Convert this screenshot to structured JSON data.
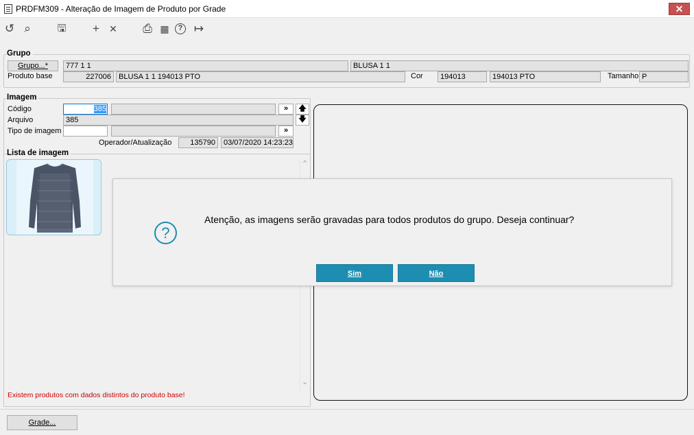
{
  "window": {
    "title": "PRDFM309 - Alteração de Imagem de Produto por Grade",
    "close": "✕"
  },
  "toolbar": {
    "icons": [
      "undo-icon",
      "search-icon",
      "save-icon",
      "add-icon",
      "delete-icon",
      "print-icon",
      "calendar-icon",
      "help-icon",
      "exit-icon"
    ],
    "glyphs": {
      "undo": "↺",
      "search": "⌕",
      "save": "🖫",
      "add": "+",
      "delete": "✕",
      "print": "⎙",
      "calendar": "▦",
      "help": "?",
      "exit": "↦"
    }
  },
  "grupo": {
    "title": "Grupo",
    "button": "Grupo...*",
    "code": "777 1 1",
    "name": "BLUSA 1 1",
    "produto_base_label": "Produto base",
    "produto_base_code": "227006",
    "produto_base_name": "BLUSA 1 1 194013 PTO",
    "cor_label": "Cor",
    "cor_code": "194013",
    "cor_name": "194013 PTO",
    "tamanho_label": "Tamanho",
    "tamanho_value": "P"
  },
  "imagem": {
    "title": "Imagem",
    "codigo_label": "Código",
    "codigo_value": "385",
    "arquivo_label": "Arquivo",
    "arquivo_value": "385",
    "tipo_label": "Tipo de imagem",
    "tipo_value": "",
    "operador_label": "Operador/Atualização",
    "operador_value": "135790",
    "atualizacao_value": "03/07/2020 14:23:23",
    "more_glyph": "»",
    "up_glyph": "🡅",
    "down_glyph": "🡇"
  },
  "lista": {
    "title": "Lista de imagem",
    "warning": "Existem produtos com dados distintos do produto base!",
    "scroll_up": "⌃",
    "scroll_down": "⌄"
  },
  "footer": {
    "grade_button": "Grade..."
  },
  "dialog": {
    "icon": "?",
    "message": "Atenção, as imagens serão gravadas para todos produtos do grupo. Deseja continuar?",
    "yes": "Sim",
    "no": "Não"
  },
  "colors": {
    "accent": "#1d8eb1",
    "warning": "#cc0000",
    "close": "#c75050"
  }
}
